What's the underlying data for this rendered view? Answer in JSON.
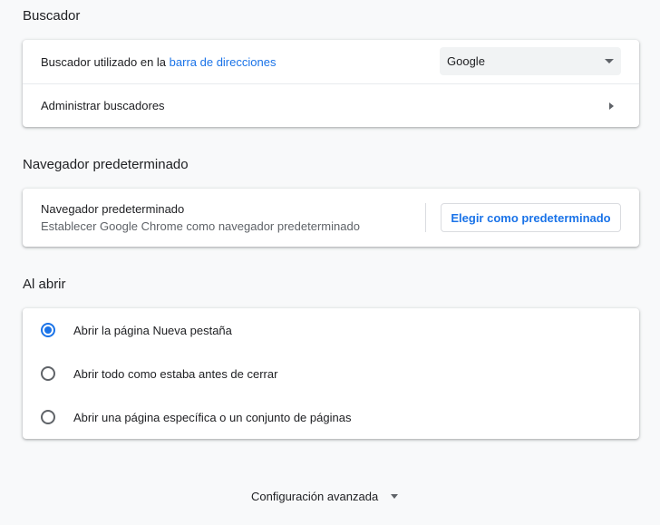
{
  "search_engine": {
    "section_title": "Buscador",
    "address_bar_prefix": "Buscador utilizado en la ",
    "address_bar_link": "barra de direcciones",
    "selected_engine": "Google",
    "manage_label": "Administrar buscadores"
  },
  "default_browser": {
    "section_title": "Navegador predeterminado",
    "row_title": "Navegador predeterminado",
    "row_subtitle": "Establecer Google Chrome como navegador predeterminado",
    "button_label": "Elegir como predeterminado"
  },
  "on_startup": {
    "section_title": "Al abrir",
    "options": [
      {
        "label": "Abrir la página Nueva pestaña",
        "checked": true
      },
      {
        "label": "Abrir todo como estaba antes de cerrar",
        "checked": false
      },
      {
        "label": "Abrir una página específica o un conjunto de páginas",
        "checked": false
      }
    ]
  },
  "advanced": {
    "label": "Configuración avanzada"
  },
  "colors": {
    "accent": "#1a73e8",
    "background": "#f8f9fa",
    "text": "#202124",
    "secondary_text": "#5f6368"
  }
}
